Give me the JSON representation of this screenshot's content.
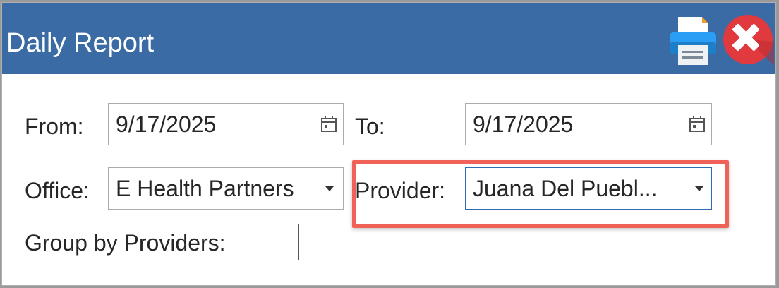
{
  "window": {
    "title": "Daily Report",
    "icons": {
      "print": "printer-icon",
      "close": "close-icon"
    },
    "colors": {
      "titlebar": "#3a6ba5",
      "close_button": "#e0393e",
      "highlight": "#f06257"
    }
  },
  "form": {
    "from": {
      "label": "From:",
      "value": "9/17/2025",
      "icon": "calendar-icon"
    },
    "to": {
      "label": "To:",
      "value": "9/17/2025",
      "icon": "calendar-icon"
    },
    "office": {
      "label": "Office:",
      "value": "E Health Partners"
    },
    "provider": {
      "label": "Provider:",
      "value": "Juana Del Puebl..."
    },
    "group_by_providers": {
      "label": "Group by Providers:",
      "checked": false
    }
  }
}
